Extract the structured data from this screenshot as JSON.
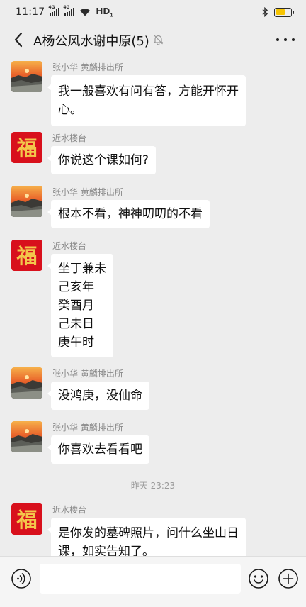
{
  "status_bar": {
    "time": "11:17",
    "signal1_tag": "4G",
    "signal2_tag": "4G",
    "network": "HD",
    "network_sub": "1",
    "battery_percent": 60,
    "battery_color": "#f6c400"
  },
  "header": {
    "title": "A杨公风水谢中原(5)",
    "mute_icon": "bell-off-icon",
    "more_icon": "more-icon"
  },
  "messages": [
    {
      "sender": "张小华  黄麟排出所",
      "avatar": "sunset-landscape",
      "lines": [
        "我一般喜欢有问有答，方能开怀开",
        "心。"
      ]
    },
    {
      "sender": "近水楼台",
      "avatar": "fu-character",
      "lines": [
        "你说这个课如何?"
      ]
    },
    {
      "sender": "张小华  黄麟排出所",
      "avatar": "sunset-landscape",
      "lines": [
        "根本不看，神神叨叨的不看"
      ]
    },
    {
      "sender": "近水楼台",
      "avatar": "fu-character",
      "lines": [
        "坐丁兼未",
        "己亥年",
        "癸酉月",
        "己未日",
        "庚午时"
      ]
    },
    {
      "sender": "张小华  黄麟排出所",
      "avatar": "sunset-landscape",
      "lines": [
        "没鸿庚，没仙命"
      ]
    },
    {
      "sender": "张小华  黄麟排出所",
      "avatar": "sunset-landscape",
      "lines": [
        "你喜欢去看看吧"
      ]
    },
    {
      "sender": "近水楼台",
      "avatar": "fu-character",
      "lines": [
        "是你发的墓碑照片，问什么坐山日",
        "课，如实告知了。"
      ]
    }
  ],
  "timestamp": "昨天 23:23",
  "fu_char": "福",
  "input_bar": {
    "placeholder": "",
    "voice_icon": "voice-icon",
    "emoji_icon": "emoji-icon",
    "plus_icon": "plus-icon"
  },
  "colors": {
    "background": "#ededed",
    "bubble": "#ffffff",
    "fu_red": "#d8101c",
    "fu_gold": "#f3c64b"
  }
}
